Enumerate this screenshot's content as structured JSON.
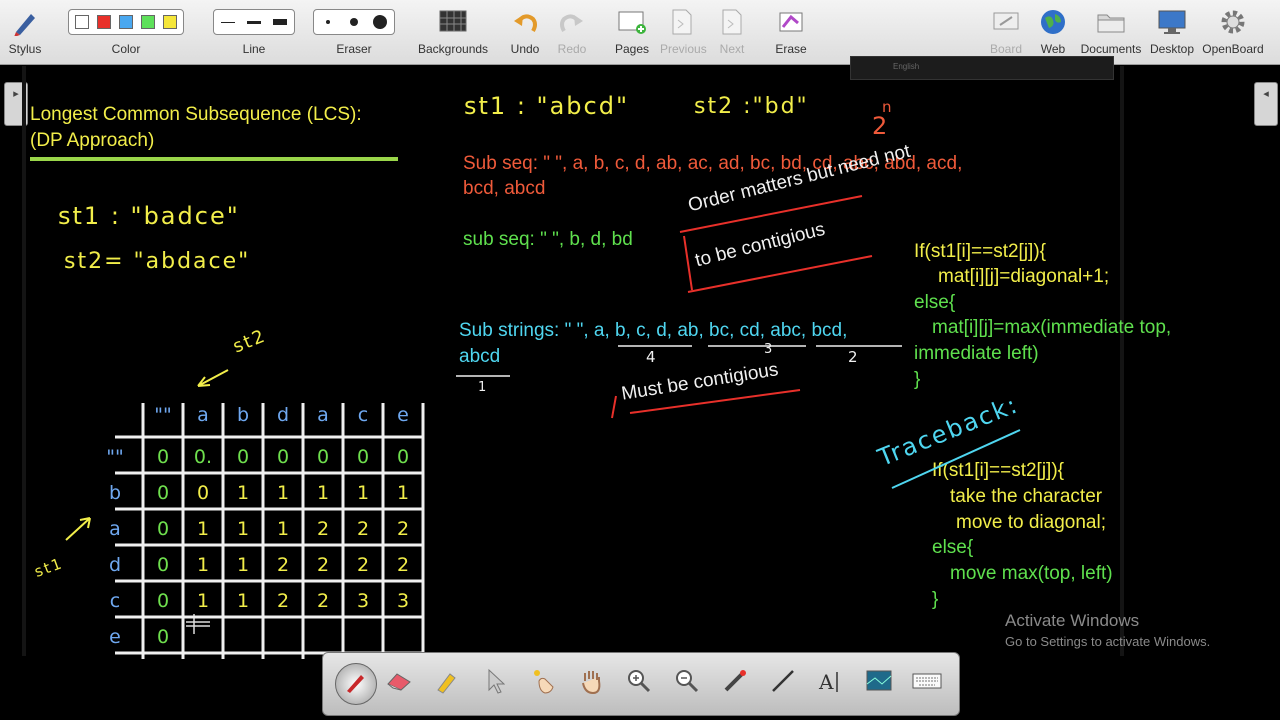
{
  "toolbar": {
    "stylus": "Stylus",
    "color": "Color",
    "line": "Line",
    "eraser": "Eraser",
    "backgrounds": "Backgrounds",
    "undo": "Undo",
    "redo": "Redo",
    "pages": "Pages",
    "previous": "Previous",
    "next": "Next",
    "erase": "Erase",
    "board": "Board",
    "web": "Web",
    "documents": "Documents",
    "desktop": "Desktop",
    "openboard": "OpenBoard",
    "colors": [
      "#ffffff",
      "#e8302a",
      "#4aa8f0",
      "#5ee05a",
      "#f5e63a"
    ]
  },
  "lang_bar": {
    "label": "English"
  },
  "board": {
    "title_line1": "Longest Common Subsequence (LCS):",
    "title_line2": "(DP Approach)",
    "st1": "st1 : \"badce\"",
    "st2": "st2= \"abdace\"",
    "example_st1": "st1 : \"abcd\"",
    "example_st2": "st2 :\"bd\"",
    "power": "2",
    "power_sup": "n",
    "subseq_line1": "Sub seq: \" \", a, b, c, d, ab, ac, ad, bc, bd, cd, abc, abd, acd,",
    "subseq_line2": "bcd, abcd",
    "subseq_green": "sub seq: \" \", b, d, bd",
    "order_note_line1": "Order matters but need not",
    "order_note_line2": "to be contigious",
    "substr_line1": "Sub strings: \" \", a, b, c, d, ab, bc, cd, abc, bcd,",
    "substr_line2": "abcd",
    "count_4": "4",
    "count_3": "3",
    "count_2": "2",
    "count_1": "1",
    "contig_note": "Must be contigious",
    "code_if": "If(st1[i]==st2[j]){",
    "code_diag": "mat[i][j]=diagonal+1;",
    "code_else": "else{",
    "code_max1": "mat[i][j]=max(immediate top,",
    "code_max2": "immediate left)",
    "code_close": "}",
    "traceback": "Traceback:",
    "tb_if": "If(st1[i]==st2[j]){",
    "tb_take": "take the character",
    "tb_move": "move to diagonal;",
    "tb_else": "else{",
    "tb_max": "move max(top, left)",
    "tb_close": "}",
    "arrow_st2": "st2",
    "arrow_st1": "st1"
  },
  "table": {
    "col_headers": [
      "\"\"",
      "a",
      "b",
      "d",
      "a",
      "c",
      "e"
    ],
    "row_headers": [
      "\"\"",
      "b",
      "a",
      "d",
      "c",
      "e"
    ],
    "rows": [
      [
        "0",
        "0.",
        "0",
        "0",
        "0",
        "0",
        "0"
      ],
      [
        "0",
        "0",
        "1",
        "1",
        "1",
        "1",
        "1"
      ],
      [
        "0",
        "1",
        "1",
        "1",
        "2",
        "2",
        "2"
      ],
      [
        "0",
        "1",
        "1",
        "2",
        "2",
        "2",
        "2"
      ],
      [
        "0",
        "1",
        "1",
        "2",
        "2",
        "3",
        "3"
      ],
      [
        "0",
        "",
        "",
        "",
        "",
        "",
        ""
      ]
    ]
  },
  "watermark": {
    "line1": "Activate Windows",
    "line2": "Go to Settings to activate Windows."
  }
}
